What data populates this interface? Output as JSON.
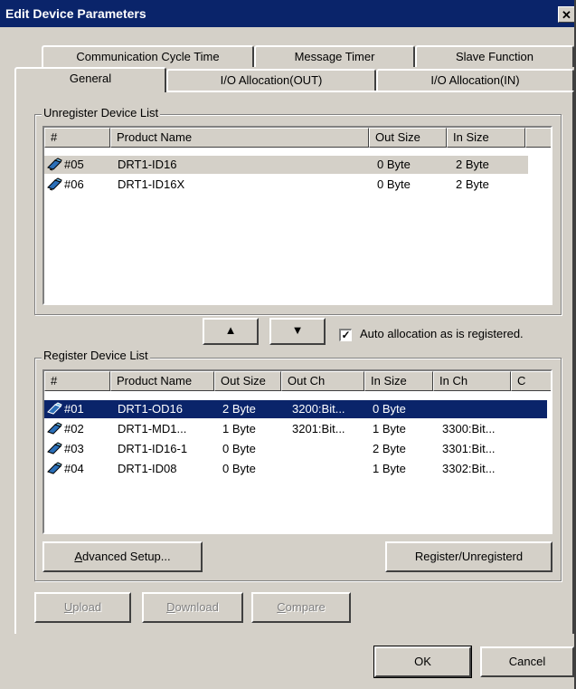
{
  "window": {
    "title": "Edit Device Parameters",
    "close_glyph": "✕"
  },
  "tabs": {
    "back": [
      "Communication Cycle Time",
      "Message Timer",
      "Slave Function"
    ],
    "front": [
      "General",
      "I/O Allocation(OUT)",
      "I/O Allocation(IN)"
    ]
  },
  "unregister": {
    "label": "Unregister Device List",
    "headers": [
      "#",
      "Product Name",
      "Out Size",
      "In Size"
    ],
    "rows": [
      {
        "num": "#05",
        "name": "DRT1-ID16",
        "out": "0 Byte",
        "in": "2 Byte"
      },
      {
        "num": "#06",
        "name": "DRT1-ID16X",
        "out": "0 Byte",
        "in": "2 Byte"
      }
    ]
  },
  "move": {
    "up_glyph": "▲",
    "down_glyph": "▼"
  },
  "auto_allocation": {
    "label": "Auto allocation as is registered.",
    "checked": "✓"
  },
  "register": {
    "label": "Register Device List",
    "headers": [
      "#",
      "Product Name",
      "Out Size",
      "Out Ch",
      "In Size",
      "In Ch",
      "C"
    ],
    "rows": [
      {
        "num": "#01",
        "name": "DRT1-OD16",
        "out": "2 Byte",
        "outch": "3200:Bit...",
        "in": "0 Byte",
        "inch": ""
      },
      {
        "num": "#02",
        "name": "DRT1-MD1...",
        "out": "1 Byte",
        "outch": "3201:Bit...",
        "in": "1 Byte",
        "inch": "3300:Bit..."
      },
      {
        "num": "#03",
        "name": "DRT1-ID16-1",
        "out": "0 Byte",
        "outch": "",
        "in": "2 Byte",
        "inch": "3301:Bit..."
      },
      {
        "num": "#04",
        "name": "DRT1-ID08",
        "out": "0 Byte",
        "outch": "",
        "in": "1 Byte",
        "inch": "3302:Bit..."
      }
    ]
  },
  "buttons": {
    "advanced_a": "A",
    "advanced_rest": "dvanced Setup...",
    "register_unregister": "Register/Unregisterd",
    "upload_u": "U",
    "upload_rest": "pload",
    "download_d": "D",
    "download_rest": "ownload",
    "compare_c": "C",
    "compare_rest": "ompare",
    "ok": "OK",
    "cancel": "Cancel"
  },
  "colors": {
    "selection": "#0a246a",
    "face": "#d4d0c8",
    "titlebar": "#0a246a"
  }
}
